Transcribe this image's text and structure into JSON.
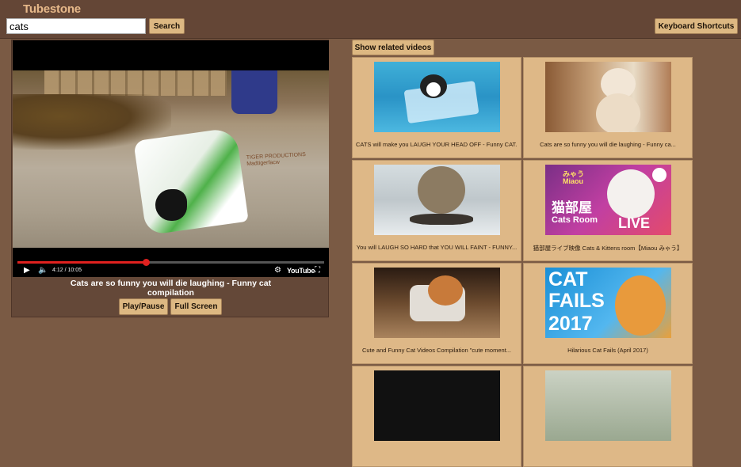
{
  "app": {
    "logo": "Tubestone"
  },
  "search": {
    "value": "cats",
    "button_label": "Search"
  },
  "header": {
    "shortcuts_label": "Keyboard Shortcuts"
  },
  "player": {
    "title": "Cats are so funny you will die laughing - Funny cat compilation",
    "time": "4:12 / 10:05",
    "progress": 0.418,
    "watermark_line1": "TIGER PRODUCTIONS",
    "watermark_line2": "Madtigerfacw",
    "brand": "YouTube",
    "play_pause_label": "Play/Pause",
    "fullscreen_label": "Full Screen",
    "icons": {
      "play": "play-icon",
      "volume": "volume-icon",
      "settings": "settings-icon",
      "fullscreen": "fullscreen-icon"
    }
  },
  "related": {
    "button_label": "Show related videos",
    "videos": [
      {
        "title": "CATS will make you LAUGH YOUR HEAD OFF - Funny CAT..."
      },
      {
        "title": "Cats are so funny you will die laughing - Funny ca..."
      },
      {
        "title": "You will LAUGH SO HARD that YOU WILL FAINT - FUNNY..."
      },
      {
        "title": "猫部屋ライブ映像 Cats & Kittens room【Miaou みゃう】",
        "thumb_text": [
          "みゃう",
          "Miaou",
          "猫部屋",
          "Cats Room",
          "LIVE"
        ]
      },
      {
        "title": "Cute and Funny Cat Videos Compilation \"cute moment..."
      },
      {
        "title": "Hilarious Cat Fails (April 2017)",
        "thumb_text": [
          "CAT",
          "FAILS",
          "2017"
        ]
      },
      {
        "title": ""
      },
      {
        "title": ""
      }
    ]
  },
  "colors": {
    "background": "#7a5a44",
    "topbar": "#644636",
    "button": "#ddb882",
    "card": "#deb887",
    "logo": "#e7b98a",
    "progress": "#e0211f"
  }
}
